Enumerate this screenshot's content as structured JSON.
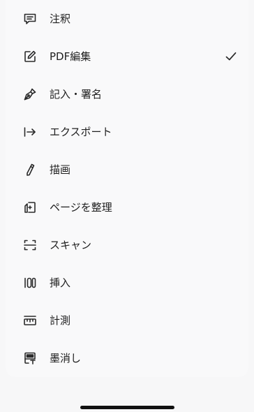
{
  "menu": {
    "items": [
      {
        "label": "注釈",
        "icon": "comment-icon",
        "selected": false
      },
      {
        "label": "PDF編集",
        "icon": "edit-icon",
        "selected": true
      },
      {
        "label": "記入・署名",
        "icon": "pen-nib-icon",
        "selected": false
      },
      {
        "label": "エクスポート",
        "icon": "export-arrow-icon",
        "selected": false
      },
      {
        "label": "描画",
        "icon": "pencil-icon",
        "selected": false
      },
      {
        "label": "ページを整理",
        "icon": "organize-pages-icon",
        "selected": false
      },
      {
        "label": "スキャン",
        "icon": "scan-icon",
        "selected": false
      },
      {
        "label": "挿入",
        "icon": "insert-icon",
        "selected": false
      },
      {
        "label": "計測",
        "icon": "ruler-icon",
        "selected": false
      },
      {
        "label": "墨消し",
        "icon": "redact-icon",
        "selected": false
      }
    ],
    "selected_indicator": "checkmark-icon"
  },
  "colors": {
    "background": "#f7f7f8",
    "text": "#1f1f1f",
    "icon": "#2a2a2a"
  }
}
